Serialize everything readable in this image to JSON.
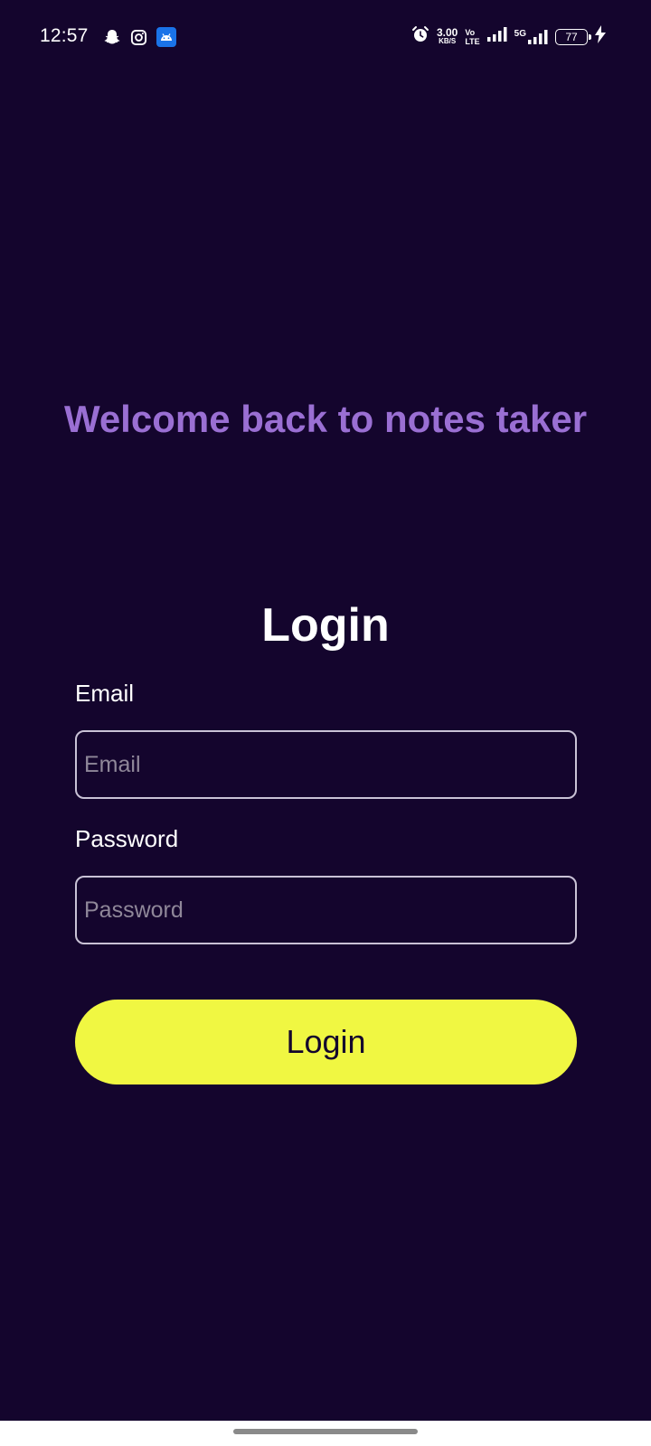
{
  "status_bar": {
    "time": "12:57",
    "notification_icons": [
      "snapchat-icon",
      "instagram-icon",
      "android-icon"
    ],
    "net_speed_value": "3.00",
    "net_speed_unit": "KB/S",
    "volte_top": "Vo",
    "volte_bottom": "LTE",
    "network_5g": "5G",
    "battery_level": "77"
  },
  "welcome_text": "Welcome back to notes taker",
  "form": {
    "title": "Login",
    "email_label": "Email",
    "email_placeholder": "Email",
    "email_value": "",
    "password_label": "Password",
    "password_placeholder": "Password",
    "password_value": "",
    "submit_label": "Login"
  },
  "colors": {
    "background": "#14052d",
    "welcome_accent": "#9a6fd3",
    "button_bg": "#f0f742",
    "button_text": "#14052d"
  }
}
